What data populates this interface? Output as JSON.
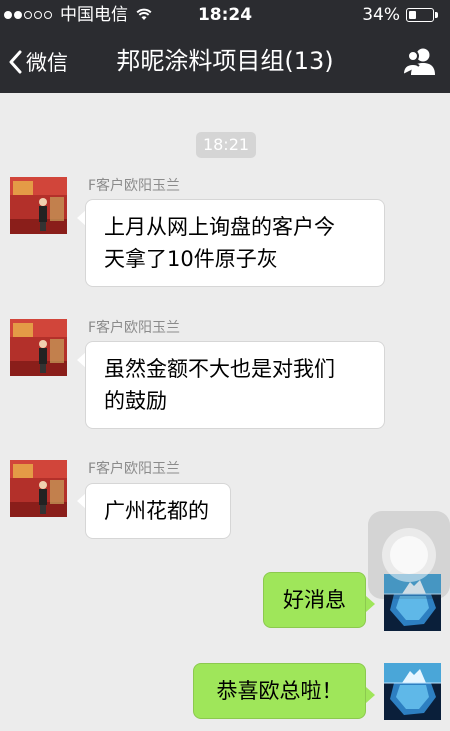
{
  "status_bar": {
    "carrier": "中国电信",
    "time": "18:24",
    "battery_percent": "34%",
    "battery_level": 0.34,
    "signal_bars_filled": 2,
    "signal_bars_total": 5,
    "wifi_icon": "wifi-icon"
  },
  "nav": {
    "back_label": "微信",
    "title": "邦昵涂料项目组(13)",
    "group_icon": "group-members-icon"
  },
  "chat": {
    "timestamp": "18:21",
    "messages": [
      {
        "direction": "in",
        "sender": "F客户欧阳玉兰",
        "lines": [
          "上月从网上询盘的客户今",
          "天拿了10件原子灰"
        ]
      },
      {
        "direction": "in",
        "sender": "F客户欧阳玉兰",
        "lines": [
          "虽然金额不大也是对我们",
          "的鼓励"
        ]
      },
      {
        "direction": "in",
        "sender": "F客户欧阳玉兰",
        "lines": [
          "广州花都的"
        ]
      },
      {
        "direction": "out",
        "lines": [
          "好消息"
        ]
      },
      {
        "direction": "out",
        "lines": [
          "恭喜欧总啦！"
        ]
      }
    ]
  },
  "colors": {
    "nav_bg": "#2b2c30",
    "chat_bg": "#ececec",
    "outgoing_bubble": "#9fe65a",
    "incoming_bubble": "#ffffff",
    "timestamp_bg": "#d5d5d5",
    "sender_name": "#8b8b8b"
  }
}
